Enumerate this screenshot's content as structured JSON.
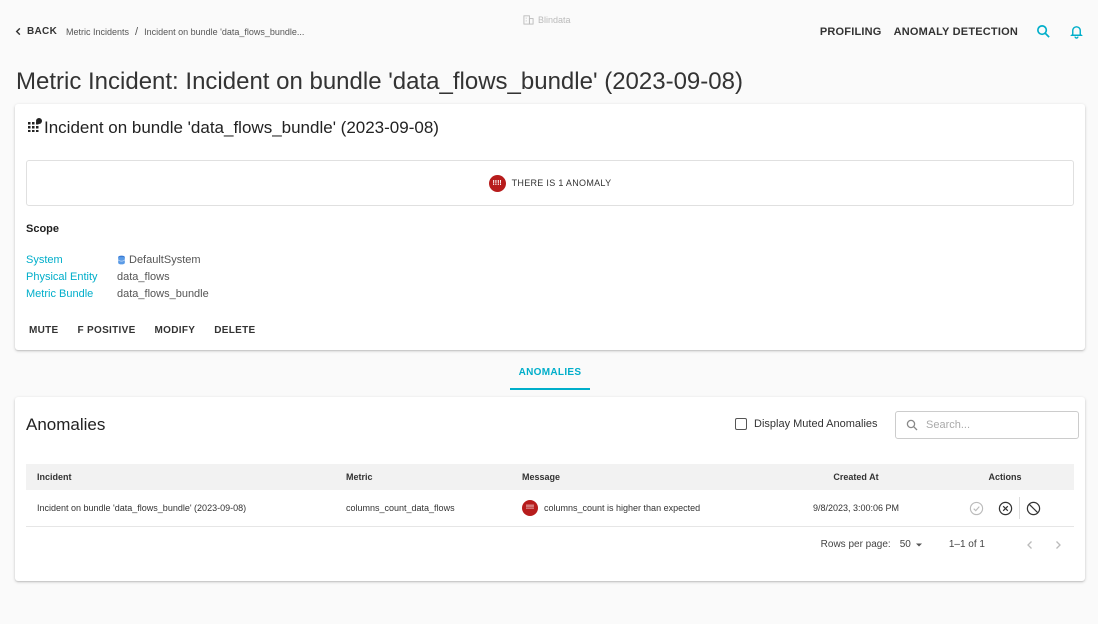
{
  "topbar": {
    "back_label": "BACK",
    "breadcrumbs": [
      "Metric Incidents",
      "Incident on bundle 'data_flows_bundle..."
    ],
    "separator": "/",
    "brand": "Blindata",
    "nav": [
      "PROFILING",
      "ANOMALY DETECTION"
    ]
  },
  "page": {
    "title": "Metric Incident: Incident on bundle 'data_flows_bundle' (2023-09-08)"
  },
  "incident_card": {
    "title": "Incident on bundle 'data_flows_bundle' (2023-09-08)",
    "anomaly_summary": "THERE IS 1 ANOMALY",
    "badge_glyph": "!!!!",
    "scope_title": "Scope",
    "scope": [
      {
        "key": "System",
        "value": "DefaultSystem",
        "icon": "database-icon"
      },
      {
        "key": "Physical Entity",
        "value": "data_flows"
      },
      {
        "key": "Metric Bundle",
        "value": "data_flows_bundle"
      }
    ],
    "actions": [
      "MUTE",
      "F POSITIVE",
      "MODIFY",
      "DELETE"
    ]
  },
  "tabs": [
    {
      "label": "ANOMALIES",
      "active": true
    }
  ],
  "anomalies": {
    "title": "Anomalies",
    "muted_toggle_label": "Display Muted Anomalies",
    "muted_checked": false,
    "search_placeholder": "Search...",
    "columns": [
      "Incident",
      "Metric",
      "Message",
      "Created At",
      "Actions"
    ],
    "rows": [
      {
        "incident": "Incident on bundle 'data_flows_bundle' (2023-09-08)",
        "metric": "columns_count_data_flows",
        "message": "columns_count is higher than expected",
        "badge_glyph": "!!!!",
        "created_at": "9/8/2023, 3:00:06 PM"
      }
    ],
    "pagination": {
      "rows_per_page_label": "Rows per page:",
      "rows_per_page": "50",
      "range": "1–1 of 1"
    }
  },
  "colors": {
    "accent": "#00aeca",
    "danger": "#b71c1c"
  }
}
